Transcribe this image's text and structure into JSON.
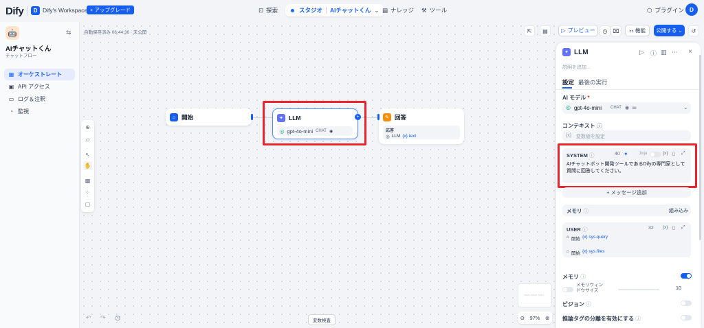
{
  "topbar": {
    "logo": "Dify",
    "workspace_initial": "D",
    "workspace_name": "Dify's Workspace",
    "upgrade_label": "+ アップグレード",
    "nav": {
      "explore": "探索",
      "studio": "スタジオ",
      "app_name": "AIチャットくん",
      "knowledge": "ナレッジ",
      "tools": "ツール"
    },
    "plugins": "プラグイン",
    "avatar": "D"
  },
  "sidebar": {
    "app_name": "AIチャットくん",
    "app_type": "チャットフロー",
    "items": [
      {
        "label": "オーケストレート",
        "icon": "orchestrate-icon",
        "active": true
      },
      {
        "label": "API アクセス",
        "icon": "api-icon",
        "active": false
      },
      {
        "label": "ログ＆注釈",
        "icon": "log-icon",
        "active": false
      },
      {
        "label": "監視",
        "icon": "monitor-icon",
        "active": false
      }
    ]
  },
  "canvas": {
    "autosave": "自動保存済み 06:44:36 · 未公開",
    "var_check": "変数検査",
    "zoom": "97%",
    "minimap_label": "~~~ ~~~ ~~~",
    "nodes": {
      "start": {
        "title": "開始"
      },
      "llm": {
        "title": "LLM",
        "model": "gpt-4o-mini",
        "mode": "CHAT"
      },
      "answer": {
        "title": "回答",
        "field_label": "応答",
        "var_source": "LLM",
        "var_name": "{x} text"
      }
    }
  },
  "header_actions": {
    "preview": "プレビュー",
    "features": "機能",
    "publish": "公開する"
  },
  "panel": {
    "title": "LLM",
    "description_placeholder": "説明を追加...",
    "tabs": [
      "設定",
      "最後の実行"
    ],
    "model_label": "AI モデル",
    "model_required": "*",
    "model_name": "gpt-4o-mini",
    "model_mode": "CHAT",
    "context_label": "コンテキスト",
    "context_placeholder": "変数値を設定",
    "system": {
      "label": "SYSTEM",
      "count": "40",
      "jinja": "Jinja",
      "text": "AIチャットボット開発ツールであるDifyの専門家として質問に回答してください。"
    },
    "add_message": "+ メッセージ追加",
    "memory_label": "メモリ",
    "memory_builtin": "組み込み",
    "user": {
      "label": "USER",
      "count": "32",
      "vars": [
        {
          "source": "開始",
          "name": "{x} sys.query"
        },
        {
          "source": "開始",
          "name": "{x} sys.files"
        }
      ]
    },
    "memory_toggle_label": "メモリ",
    "memory_window_label": "メモリウィンドウサイズ",
    "memory_window_value": "10",
    "vision_label": "ビジョン",
    "reasoning_label": "推論タグの分離を有効にする"
  },
  "colors": {
    "accent": "#155eef",
    "highlight": "#e8242c"
  }
}
